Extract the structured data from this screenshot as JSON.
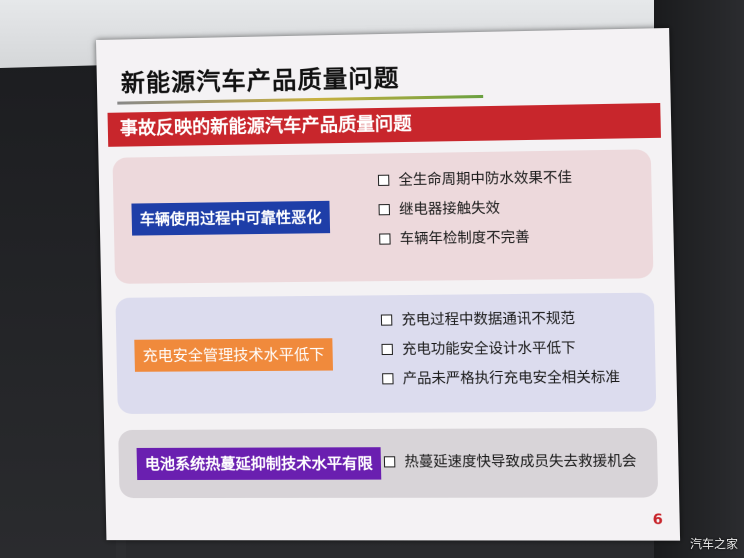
{
  "slide": {
    "title": "新能源汽车产品质量问题",
    "banner": "事故反映的新能源汽车产品质量问题",
    "page_number": "6",
    "colors": {
      "banner": "#c8262c",
      "tag_1": "#1e3ea8",
      "tag_2": "#f08a3c",
      "tag_3": "#6a1fb0"
    },
    "panels": [
      {
        "tag": "车辆使用过程中可靠性恶化",
        "items": [
          "全生命周期中防水效果不佳",
          "继电器接触失效",
          "车辆年检制度不完善"
        ]
      },
      {
        "tag": "充电安全管理技术水平低下",
        "items": [
          "充电过程中数据通讯不规范",
          "充电功能安全设计水平低下",
          "产品未严格执行充电安全相关标准"
        ]
      },
      {
        "tag": "电池系统热蔓延抑制技术水平有限",
        "items": [
          "热蔓延速度快导致成员失去救援机会"
        ]
      }
    ]
  },
  "watermark": "汽车之家"
}
